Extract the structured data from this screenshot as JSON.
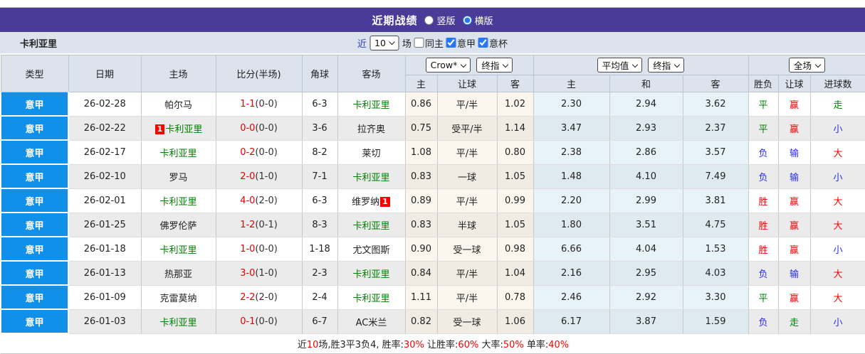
{
  "colors": {
    "titlebar_bg": "#4b3b98",
    "panel_bg": "#dce3ed",
    "league_bg": "#1090e9",
    "team_green": "#008000",
    "score_red": "#e60000",
    "link_blue": "#2f3cc8",
    "result_red": "#fe0000",
    "result_blue": "#2b2bf5",
    "result_green": "#008000",
    "control_blue": "#2677f2"
  },
  "titlebar": {
    "title": "近期战绩",
    "radios": [
      {
        "label": "竖版",
        "checked": false
      },
      {
        "label": "横版",
        "checked": true
      }
    ]
  },
  "subheader": {
    "team": "卡利亚里",
    "recent_label": "近",
    "recent_count": "10",
    "matches_label": "场",
    "checkboxes": [
      {
        "label": "同主",
        "checked": false
      },
      {
        "label": "意甲",
        "checked": true
      },
      {
        "label": "意杯",
        "checked": true
      }
    ]
  },
  "table": {
    "left_headers": [
      "类型",
      "日期",
      "主场",
      "比分(半场)",
      "角球",
      "客场"
    ],
    "groups": [
      {
        "selects": [
          "Crow*",
          "终指"
        ],
        "sub": [
          "主",
          "让球",
          "客"
        ]
      },
      {
        "selects": [
          "平均值",
          "终指"
        ],
        "sub": [
          "主",
          "和",
          "客"
        ]
      },
      {
        "selects": [
          "全场"
        ],
        "sub": [
          "胜负",
          "让球",
          "进球数"
        ]
      }
    ],
    "rows": [
      {
        "league": "意甲",
        "date": "26-02-28",
        "home": {
          "name": "帕尔马",
          "green": false
        },
        "score": "1-1",
        "half": "(0-0)",
        "corner": "6-3",
        "away": {
          "name": "卡利亚里",
          "green": true
        },
        "odds": [
          "0.86",
          "平/半",
          "1.02"
        ],
        "avg": [
          "2.30",
          "2.94",
          "3.62"
        ],
        "results": [
          {
            "t": "平",
            "c": "green"
          },
          {
            "t": "赢",
            "c": "red"
          },
          {
            "t": "走",
            "c": "green"
          }
        ]
      },
      {
        "league": "意甲",
        "date": "26-02-22",
        "home": {
          "name": "卡利亚里",
          "green": true,
          "badge": "1",
          "badge_pos": "before"
        },
        "score": "0-0",
        "half": "(0-0)",
        "corner": "3-6",
        "away": {
          "name": "拉齐奥",
          "green": false
        },
        "odds": [
          "0.75",
          "受平/半",
          "1.14"
        ],
        "avg": [
          "3.47",
          "2.93",
          "2.37"
        ],
        "results": [
          {
            "t": "平",
            "c": "green"
          },
          {
            "t": "赢",
            "c": "red"
          },
          {
            "t": "小",
            "c": "blue"
          }
        ]
      },
      {
        "league": "意甲",
        "date": "26-02-17",
        "home": {
          "name": "卡利亚里",
          "green": true
        },
        "score": "0-2",
        "half": "(0-0)",
        "corner": "8-2",
        "away": {
          "name": "莱切",
          "green": false
        },
        "odds": [
          "1.08",
          "平/半",
          "0.80"
        ],
        "avg": [
          "2.38",
          "2.86",
          "3.57"
        ],
        "results": [
          {
            "t": "负",
            "c": "blue"
          },
          {
            "t": "输",
            "c": "blue"
          },
          {
            "t": "大",
            "c": "red"
          }
        ]
      },
      {
        "league": "意甲",
        "date": "26-02-10",
        "home": {
          "name": "罗马",
          "green": false
        },
        "score": "2-0",
        "half": "(1-0)",
        "corner": "7-1",
        "away": {
          "name": "卡利亚里",
          "green": true
        },
        "odds": [
          "0.83",
          "一球",
          "1.05"
        ],
        "avg": [
          "1.48",
          "4.10",
          "7.49"
        ],
        "results": [
          {
            "t": "负",
            "c": "blue"
          },
          {
            "t": "输",
            "c": "blue"
          },
          {
            "t": "小",
            "c": "blue"
          }
        ]
      },
      {
        "league": "意甲",
        "date": "26-02-01",
        "home": {
          "name": "卡利亚里",
          "green": true
        },
        "score": "4-0",
        "half": "(2-0)",
        "corner": "6-3",
        "away": {
          "name": "维罗纳",
          "green": false,
          "badge": "1",
          "badge_pos": "after"
        },
        "odds": [
          "0.89",
          "平/半",
          "0.99"
        ],
        "avg": [
          "2.20",
          "2.99",
          "3.81"
        ],
        "results": [
          {
            "t": "胜",
            "c": "red"
          },
          {
            "t": "赢",
            "c": "red"
          },
          {
            "t": "大",
            "c": "red"
          }
        ]
      },
      {
        "league": "意甲",
        "date": "26-01-25",
        "home": {
          "name": "佛罗伦萨",
          "green": false
        },
        "score": "1-2",
        "half": "(0-1)",
        "corner": "8-3",
        "away": {
          "name": "卡利亚里",
          "green": true
        },
        "odds": [
          "0.83",
          "半球",
          "1.05"
        ],
        "avg": [
          "1.80",
          "3.51",
          "4.75"
        ],
        "results": [
          {
            "t": "胜",
            "c": "red"
          },
          {
            "t": "赢",
            "c": "red"
          },
          {
            "t": "大",
            "c": "red"
          }
        ]
      },
      {
        "league": "意甲",
        "date": "26-01-18",
        "home": {
          "name": "卡利亚里",
          "green": true
        },
        "score": "1-0",
        "half": "(0-0)",
        "corner": "1-18",
        "away": {
          "name": "尤文图斯",
          "green": false
        },
        "odds": [
          "0.90",
          "受一球",
          "0.98"
        ],
        "avg": [
          "6.66",
          "4.04",
          "1.53"
        ],
        "results": [
          {
            "t": "胜",
            "c": "red"
          },
          {
            "t": "赢",
            "c": "red"
          },
          {
            "t": "小",
            "c": "blue"
          }
        ]
      },
      {
        "league": "意甲",
        "date": "26-01-13",
        "home": {
          "name": "热那亚",
          "green": false
        },
        "score": "3-0",
        "half": "(1-0)",
        "corner": "2-3",
        "away": {
          "name": "卡利亚里",
          "green": true
        },
        "odds": [
          "0.84",
          "平/半",
          "1.04"
        ],
        "avg": [
          "2.16",
          "2.95",
          "4.03"
        ],
        "results": [
          {
            "t": "负",
            "c": "blue"
          },
          {
            "t": "输",
            "c": "blue"
          },
          {
            "t": "大",
            "c": "red"
          }
        ]
      },
      {
        "league": "意甲",
        "date": "26-01-09",
        "home": {
          "name": "克雷莫纳",
          "green": false
        },
        "score": "2-2",
        "half": "(2-0)",
        "corner": "2-4",
        "away": {
          "name": "卡利亚里",
          "green": true
        },
        "odds": [
          "1.11",
          "平/半",
          "0.78"
        ],
        "avg": [
          "2.46",
          "2.92",
          "3.30"
        ],
        "results": [
          {
            "t": "平",
            "c": "green"
          },
          {
            "t": "赢",
            "c": "red"
          },
          {
            "t": "大",
            "c": "red"
          }
        ]
      },
      {
        "league": "意甲",
        "date": "26-01-03",
        "home": {
          "name": "卡利亚里",
          "green": true
        },
        "score": "0-1",
        "half": "(0-0)",
        "corner": "6-7",
        "away": {
          "name": "AC米兰",
          "green": false
        },
        "odds": [
          "0.82",
          "受一球",
          "1.06"
        ],
        "avg": [
          "6.17",
          "3.87",
          "1.59"
        ],
        "results": [
          {
            "t": "负",
            "c": "blue"
          },
          {
            "t": "走",
            "c": "green"
          },
          {
            "t": "小",
            "c": "blue"
          }
        ]
      }
    ]
  },
  "footer": {
    "segments": [
      {
        "text": "近",
        "red": false
      },
      {
        "text": "10",
        "red": true
      },
      {
        "text": "场,胜3平3负4, 胜率:",
        "red": false
      },
      {
        "text": "30%",
        "red": true
      },
      {
        "text": " 让胜率:",
        "red": false
      },
      {
        "text": "60%",
        "red": true
      },
      {
        "text": " 大率:",
        "red": false
      },
      {
        "text": "50%",
        "red": true
      },
      {
        "text": " 单率:",
        "red": false
      },
      {
        "text": "40%",
        "red": true
      }
    ]
  }
}
